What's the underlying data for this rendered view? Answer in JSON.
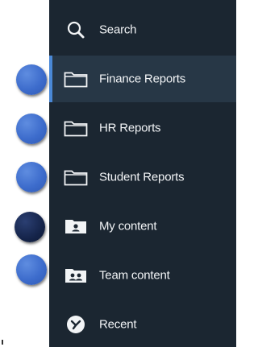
{
  "sidebar": {
    "items": [
      {
        "label": "Search",
        "icon": "search-icon",
        "selected": false
      },
      {
        "label": "Finance Reports",
        "icon": "folder-icon",
        "selected": true
      },
      {
        "label": "HR Reports",
        "icon": "folder-icon",
        "selected": false
      },
      {
        "label": "Student Reports",
        "icon": "folder-icon",
        "selected": false
      },
      {
        "label": "My content",
        "icon": "my-content-icon",
        "selected": false
      },
      {
        "label": "Team content",
        "icon": "team-content-icon",
        "selected": false
      },
      {
        "label": "Recent",
        "icon": "recent-icon",
        "selected": false
      }
    ],
    "colors": {
      "background": "#1b2631",
      "selected_background": "#273746",
      "selected_accent": "#4a88d6",
      "text": "#f2f4f6"
    }
  },
  "annotation_dots": [
    {
      "style": "blue"
    },
    {
      "style": "blue"
    },
    {
      "style": "blue"
    },
    {
      "style": "dark"
    },
    {
      "style": "blue"
    }
  ]
}
